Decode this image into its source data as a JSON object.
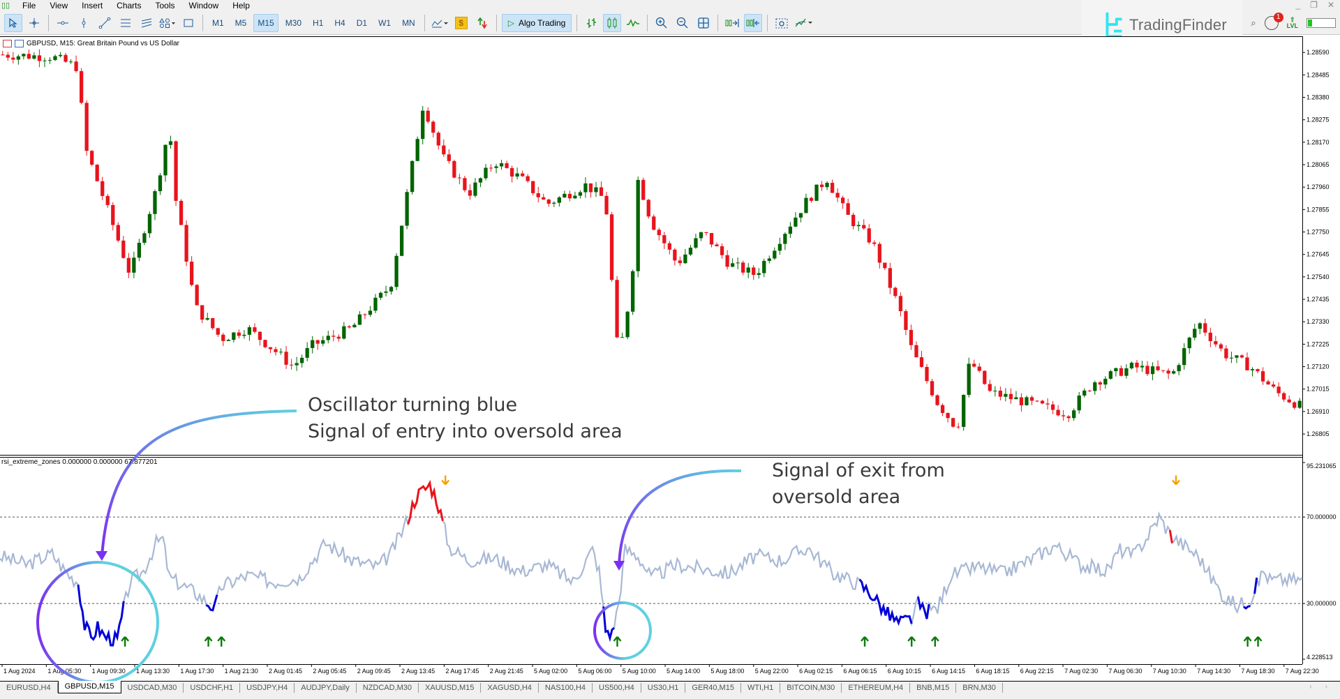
{
  "menu": {
    "items": [
      "File",
      "View",
      "Insert",
      "Charts",
      "Tools",
      "Window",
      "Help"
    ]
  },
  "toolbar": {
    "timeframes": [
      "M1",
      "M5",
      "M15",
      "M30",
      "H1",
      "H4",
      "D1",
      "W1",
      "MN"
    ],
    "active_timeframe": "M15",
    "algo_trading_label": "Algo Trading",
    "tools": [
      "cursor-icon",
      "crosshair-icon",
      "horizontal-line-icon",
      "vertical-line-icon",
      "trendline-icon",
      "equidistant-channel-icon",
      "fibonacci-icon",
      "shapes-icon",
      "rectangle-icon"
    ],
    "chart_tools": [
      "bar-chart-icon",
      "candlestick-icon",
      "line-chart-icon",
      "zoom-in-icon",
      "zoom-out-icon",
      "tile-windows-icon",
      "autoscroll-icon",
      "chart-shift-icon",
      "screenshot-icon",
      "indicators-icon"
    ]
  },
  "branding": {
    "name": "TradingFinder",
    "accent": "#2ee6f0"
  },
  "status": {
    "notifications": "1",
    "level_label": "LVL",
    "level_fill": 0.15
  },
  "chart": {
    "title": "GBPUSD, M15:  Great Britain Pound vs US Dollar",
    "price_ticks": [
      "1.28590",
      "1.28485",
      "1.28380",
      "1.28275",
      "1.28170",
      "1.28065",
      "1.27960",
      "1.27855",
      "1.27750",
      "1.27645",
      "1.27540",
      "1.27435",
      "1.27330",
      "1.27225",
      "1.27120",
      "1.27015",
      "1.26910",
      "1.26805"
    ],
    "price_range": [
      1.2674,
      1.2862
    ],
    "bull_color": "#006400",
    "bear_color": "#e8141c",
    "time_labels": [
      "1 Aug 2024",
      "1 Aug 05:30",
      "1 Aug 09:30",
      "1 Aug 13:30",
      "1 Aug 17:30",
      "1 Aug 21:30",
      "2 Aug 01:45",
      "2 Aug 05:45",
      "2 Aug 09:45",
      "2 Aug 13:45",
      "2 Aug 17:45",
      "2 Aug 21:45",
      "5 Aug 02:00",
      "5 Aug 06:00",
      "5 Aug 10:00",
      "5 Aug 14:00",
      "5 Aug 18:00",
      "5 Aug 22:00",
      "6 Aug 02:15",
      "6 Aug 06:15",
      "6 Aug 10:15",
      "6 Aug 14:15",
      "6 Aug 18:15",
      "6 Aug 22:15",
      "7 Aug 02:30",
      "7 Aug 06:30",
      "7 Aug 10:30",
      "7 Aug 14:30",
      "7 Aug 18:30",
      "7 Aug 22:30"
    ],
    "price_path": [
      [
        0,
        1.2858
      ],
      [
        0.04,
        1.2857
      ],
      [
        0.06,
        1.2852
      ],
      [
        0.065,
        1.2815
      ],
      [
        0.08,
        1.279
      ],
      [
        0.1,
        1.2755
      ],
      [
        0.12,
        1.2795
      ],
      [
        0.13,
        1.2825
      ],
      [
        0.135,
        1.279
      ],
      [
        0.15,
        1.274
      ],
      [
        0.17,
        1.2725
      ],
      [
        0.19,
        1.273
      ],
      [
        0.21,
        1.272
      ],
      [
        0.225,
        1.2712
      ],
      [
        0.24,
        1.2722
      ],
      [
        0.27,
        1.273
      ],
      [
        0.3,
        1.275
      ],
      [
        0.325,
        1.2835
      ],
      [
        0.34,
        1.281
      ],
      [
        0.36,
        1.2793
      ],
      [
        0.38,
        1.2808
      ],
      [
        0.4,
        1.28
      ],
      [
        0.42,
        1.2788
      ],
      [
        0.45,
        1.2797
      ],
      [
        0.465,
        1.279
      ],
      [
        0.47,
        1.275
      ],
      [
        0.475,
        1.2715
      ],
      [
        0.485,
        1.275
      ],
      [
        0.49,
        1.28
      ],
      [
        0.5,
        1.278
      ],
      [
        0.52,
        1.276
      ],
      [
        0.54,
        1.2775
      ],
      [
        0.56,
        1.276
      ],
      [
        0.58,
        1.2755
      ],
      [
        0.6,
        1.2773
      ],
      [
        0.62,
        1.279
      ],
      [
        0.635,
        1.28
      ],
      [
        0.65,
        1.2783
      ],
      [
        0.67,
        1.277
      ],
      [
        0.69,
        1.274
      ],
      [
        0.7,
        1.272
      ],
      [
        0.72,
        1.2695
      ],
      [
        0.735,
        1.2683
      ],
      [
        0.745,
        1.2715
      ],
      [
        0.76,
        1.27
      ],
      [
        0.79,
        1.2695
      ],
      [
        0.82,
        1.269
      ],
      [
        0.84,
        1.2705
      ],
      [
        0.87,
        1.2712
      ],
      [
        0.9,
        1.2708
      ],
      [
        0.92,
        1.2733
      ],
      [
        0.94,
        1.2718
      ],
      [
        0.96,
        1.2712
      ],
      [
        0.98,
        1.27
      ],
      [
        1.0,
        1.2693
      ]
    ]
  },
  "oscillator": {
    "label": "rsi_extreme_zones 0.000000 0.000000 67.877201",
    "ticks": [
      "95.231065",
      "70.000000",
      "30.000000",
      "4.228513"
    ],
    "range": [
      4.228513,
      95.231065
    ],
    "upper_level": 70,
    "lower_level": 30,
    "neutral_color": "#a8b8d4",
    "oversold_color": "#0000d8",
    "overbought_color": "#e8141c",
    "buy_arrow_color": "#0a7a0a",
    "sell_arrow_color": "#f5a000",
    "path": [
      [
        0,
        52
      ],
      [
        0.02,
        48
      ],
      [
        0.04,
        53
      ],
      [
        0.05,
        45
      ],
      [
        0.055,
        42
      ],
      [
        0.06,
        40
      ],
      [
        0.065,
        20
      ],
      [
        0.07,
        14
      ],
      [
        0.075,
        19
      ],
      [
        0.08,
        15
      ],
      [
        0.09,
        13
      ],
      [
        0.095,
        28
      ],
      [
        0.1,
        40
      ],
      [
        0.11,
        45
      ],
      [
        0.12,
        58
      ],
      [
        0.125,
        60
      ],
      [
        0.13,
        42
      ],
      [
        0.15,
        35
      ],
      [
        0.16,
        30
      ],
      [
        0.165,
        28
      ],
      [
        0.17,
        38
      ],
      [
        0.19,
        43
      ],
      [
        0.21,
        40
      ],
      [
        0.23,
        42
      ],
      [
        0.25,
        58
      ],
      [
        0.27,
        50
      ],
      [
        0.29,
        47
      ],
      [
        0.3,
        53
      ],
      [
        0.31,
        65
      ],
      [
        0.32,
        80
      ],
      [
        0.33,
        85
      ],
      [
        0.335,
        79
      ],
      [
        0.345,
        56
      ],
      [
        0.36,
        50
      ],
      [
        0.38,
        51
      ],
      [
        0.4,
        45
      ],
      [
        0.42,
        48
      ],
      [
        0.44,
        40
      ],
      [
        0.455,
        55
      ],
      [
        0.46,
        45
      ],
      [
        0.465,
        18
      ],
      [
        0.47,
        16
      ],
      [
        0.475,
        30
      ],
      [
        0.48,
        55
      ],
      [
        0.49,
        52
      ],
      [
        0.5,
        42
      ],
      [
        0.52,
        48
      ],
      [
        0.54,
        46
      ],
      [
        0.56,
        44
      ],
      [
        0.58,
        52
      ],
      [
        0.6,
        50
      ],
      [
        0.62,
        56
      ],
      [
        0.64,
        44
      ],
      [
        0.66,
        39
      ],
      [
        0.67,
        34
      ],
      [
        0.68,
        26
      ],
      [
        0.69,
        21
      ],
      [
        0.7,
        23
      ],
      [
        0.705,
        30
      ],
      [
        0.71,
        26
      ],
      [
        0.72,
        28
      ],
      [
        0.73,
        43
      ],
      [
        0.75,
        47
      ],
      [
        0.77,
        44
      ],
      [
        0.79,
        50
      ],
      [
        0.81,
        57
      ],
      [
        0.83,
        48
      ],
      [
        0.85,
        45
      ],
      [
        0.86,
        55
      ],
      [
        0.87,
        52
      ],
      [
        0.88,
        60
      ],
      [
        0.89,
        70
      ],
      [
        0.9,
        61
      ],
      [
        0.92,
        52
      ],
      [
        0.93,
        42
      ],
      [
        0.94,
        33
      ],
      [
        0.95,
        29
      ],
      [
        0.96,
        32
      ],
      [
        0.97,
        45
      ],
      [
        0.975,
        41
      ]
    ],
    "oversold_segments": [
      [
        0.06,
        0.095
      ],
      [
        0.157,
        0.168
      ],
      [
        0.463,
        0.472
      ],
      [
        0.66,
        0.7
      ],
      [
        0.705,
        0.714
      ],
      [
        0.955,
        0.96
      ],
      [
        0.962,
        0.966
      ]
    ],
    "overbought_segments": [
      [
        0.313,
        0.34
      ],
      [
        0.897,
        0.9
      ]
    ],
    "buy_arrows": [
      0.096,
      0.16,
      0.17,
      0.474,
      0.664,
      0.7,
      0.718,
      0.958,
      0.966
    ],
    "sell_arrows": [
      0.342,
      0.903
    ]
  },
  "annotations": [
    {
      "lines": [
        "Oscillator turning blue",
        "Signal of entry into oversold area"
      ]
    },
    {
      "lines": [
        "Signal of exit from",
        "oversold area"
      ]
    }
  ],
  "symbol_tabs": [
    "EURUSD,H4",
    "GBPUSD,M15",
    "USDCAD,M30",
    "USDCHF,H1",
    "USDJPY,H4",
    "AUDJPY,Daily",
    "NZDCAD,M30",
    "XAUUSD,M15",
    "XAGUSD,H4",
    "NAS100,H4",
    "US500,H4",
    "US30,H1",
    "GER40,M15",
    "WTI,H1",
    "BITCOIN,M30",
    "ETHEREUM,H4",
    "BNB,M15",
    "BRN,M30"
  ],
  "active_symbol_tab": "GBPUSD,M15"
}
